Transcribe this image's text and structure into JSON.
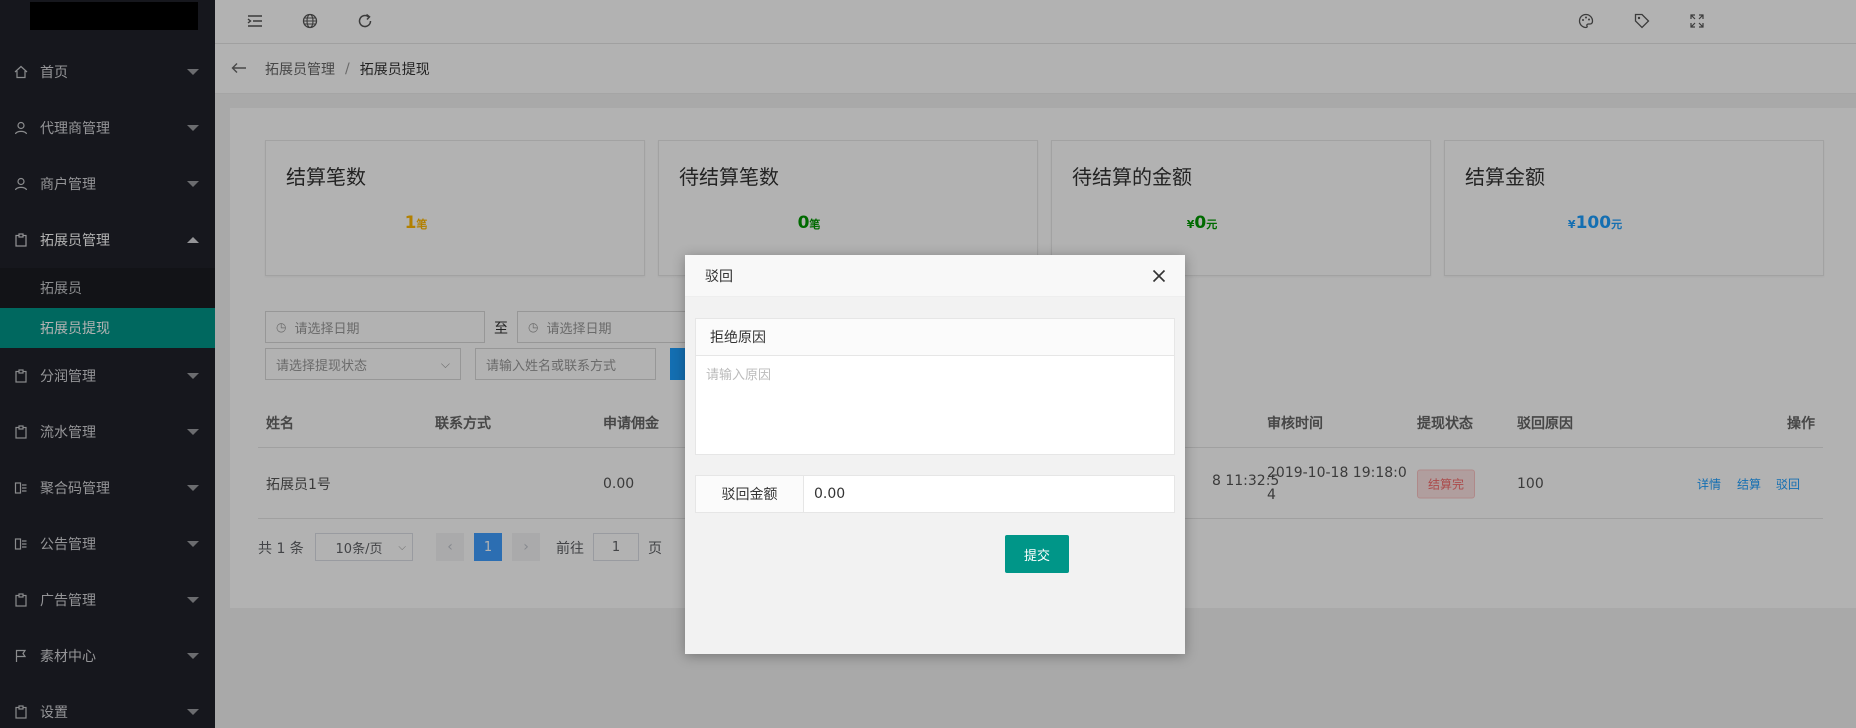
{
  "sidebar": {
    "items": [
      {
        "label": "首页",
        "icon": "home-icon"
      },
      {
        "label": "代理商管理",
        "icon": "user-icon"
      },
      {
        "label": "商户管理",
        "icon": "user-icon"
      },
      {
        "label": "拓展员管理",
        "icon": "clipboard-icon",
        "expanded": true
      },
      {
        "label": "分润管理",
        "icon": "clipboard-icon"
      },
      {
        "label": "流水管理",
        "icon": "clipboard-icon"
      },
      {
        "label": "聚合码管理",
        "icon": "app-icon"
      },
      {
        "label": "公告管理",
        "icon": "app-icon"
      },
      {
        "label": "广告管理",
        "icon": "clipboard-icon"
      },
      {
        "label": "素材中心",
        "icon": "flag-icon"
      },
      {
        "label": "设置",
        "icon": "clipboard-icon"
      }
    ],
    "sub_items": [
      {
        "label": "拓展员",
        "active": false
      },
      {
        "label": "拓展员提现",
        "active": true
      }
    ],
    "active_color": "#009688"
  },
  "breadcrumb": {
    "parent": "拓展员管理",
    "separator": "/",
    "current": "拓展员提现"
  },
  "stats": [
    {
      "title": "结算笔数",
      "prefix": "",
      "value": "1",
      "unit": "笔",
      "color": "#ffb800"
    },
    {
      "title": "待结算笔数",
      "prefix": "",
      "value": "0",
      "unit": "笔",
      "color": "#009900"
    },
    {
      "title": "待结算的金额",
      "prefix": "¥",
      "value": "0",
      "unit": "元",
      "color": "#009900"
    },
    {
      "title": "结算金额",
      "prefix": "¥",
      "value": "100",
      "unit": "元",
      "color": "#1e9fff"
    }
  ],
  "filters": {
    "date_start_placeholder": "请选择日期",
    "to_label": "至",
    "date_end_placeholder": "请选择日期",
    "status_placeholder": "请选择提现状态",
    "keyword_placeholder": "请输入姓名或联系方式"
  },
  "table": {
    "headers": {
      "name": "姓名",
      "contact": "联系方式",
      "commission": "申请佣金",
      "review_time": "审核时间",
      "status": "提现状态",
      "reject_reason": "驳回原因",
      "actions": "操作"
    },
    "rows": [
      {
        "name": "拓展员1号",
        "commission": "0.00",
        "apply_time_partial": "8 11:32:5",
        "review_time_line1": "2019-10-18 19:18:0",
        "review_time_line2": "4",
        "status": "结算完",
        "reject_reason": "100",
        "actions": [
          "详情",
          "结算",
          "驳回"
        ]
      }
    ]
  },
  "pagination": {
    "total": "共 1 条",
    "page_size": "10条/页",
    "current_page": "1",
    "goto_label": "前往",
    "goto_value": "1",
    "page_label": "页"
  },
  "modal": {
    "title": "驳回",
    "reason_label": "拒绝原因",
    "reason_placeholder": "请输入原因",
    "amount_label": "驳回金额",
    "amount_value": "0.00",
    "submit_label": "提交"
  }
}
